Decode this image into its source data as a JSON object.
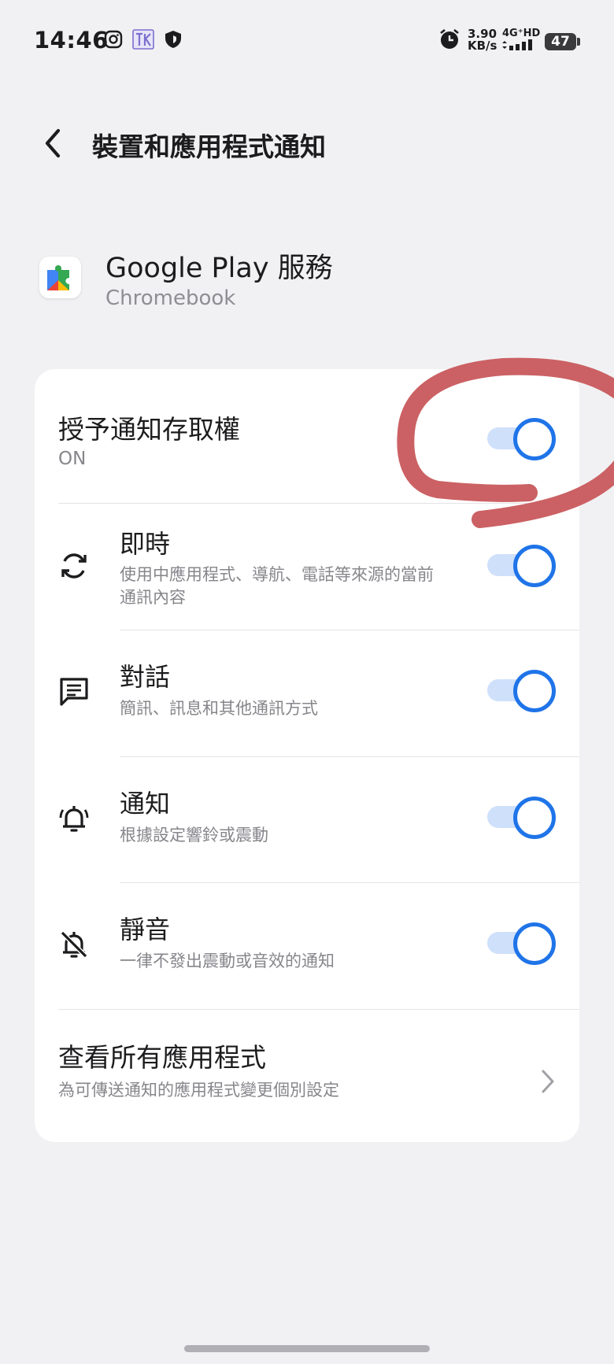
{
  "status_bar": {
    "time": "14:46",
    "speed_value": "3.90",
    "speed_unit": "KB/s",
    "network": "4G⁺HD",
    "battery": "47",
    "icons": [
      "instagram-icon",
      "app-icon",
      "shield-icon",
      "alarm-icon",
      "signal-icon"
    ]
  },
  "header": {
    "title": "裝置和應用程式通知"
  },
  "app": {
    "name": "Google Play 服務",
    "subtitle": "Chromebook"
  },
  "settings": {
    "access": {
      "title": "授予通知存取權",
      "subtitle": "ON",
      "enabled": true
    },
    "items": [
      {
        "title": "即時",
        "subtitle": "使用中應用程式、導航、電話等來源的當前通訊內容",
        "icon": "sync-icon",
        "enabled": true
      },
      {
        "title": "對話",
        "subtitle": "簡訊、訊息和其他通訊方式",
        "icon": "chat-icon",
        "enabled": true
      },
      {
        "title": "通知",
        "subtitle": "根據設定響鈴或震動",
        "icon": "bell-ring-icon",
        "enabled": true
      },
      {
        "title": "靜音",
        "subtitle": "一律不發出震動或音效的通知",
        "icon": "bell-off-icon",
        "enabled": true
      }
    ],
    "all_apps": {
      "title": "查看所有應用程式",
      "subtitle": "為可傳送通知的應用程式變更個別設定"
    }
  },
  "colors": {
    "accent": "#1f74e8",
    "track": "#cfe0fb",
    "annotation": "#c8585c"
  }
}
